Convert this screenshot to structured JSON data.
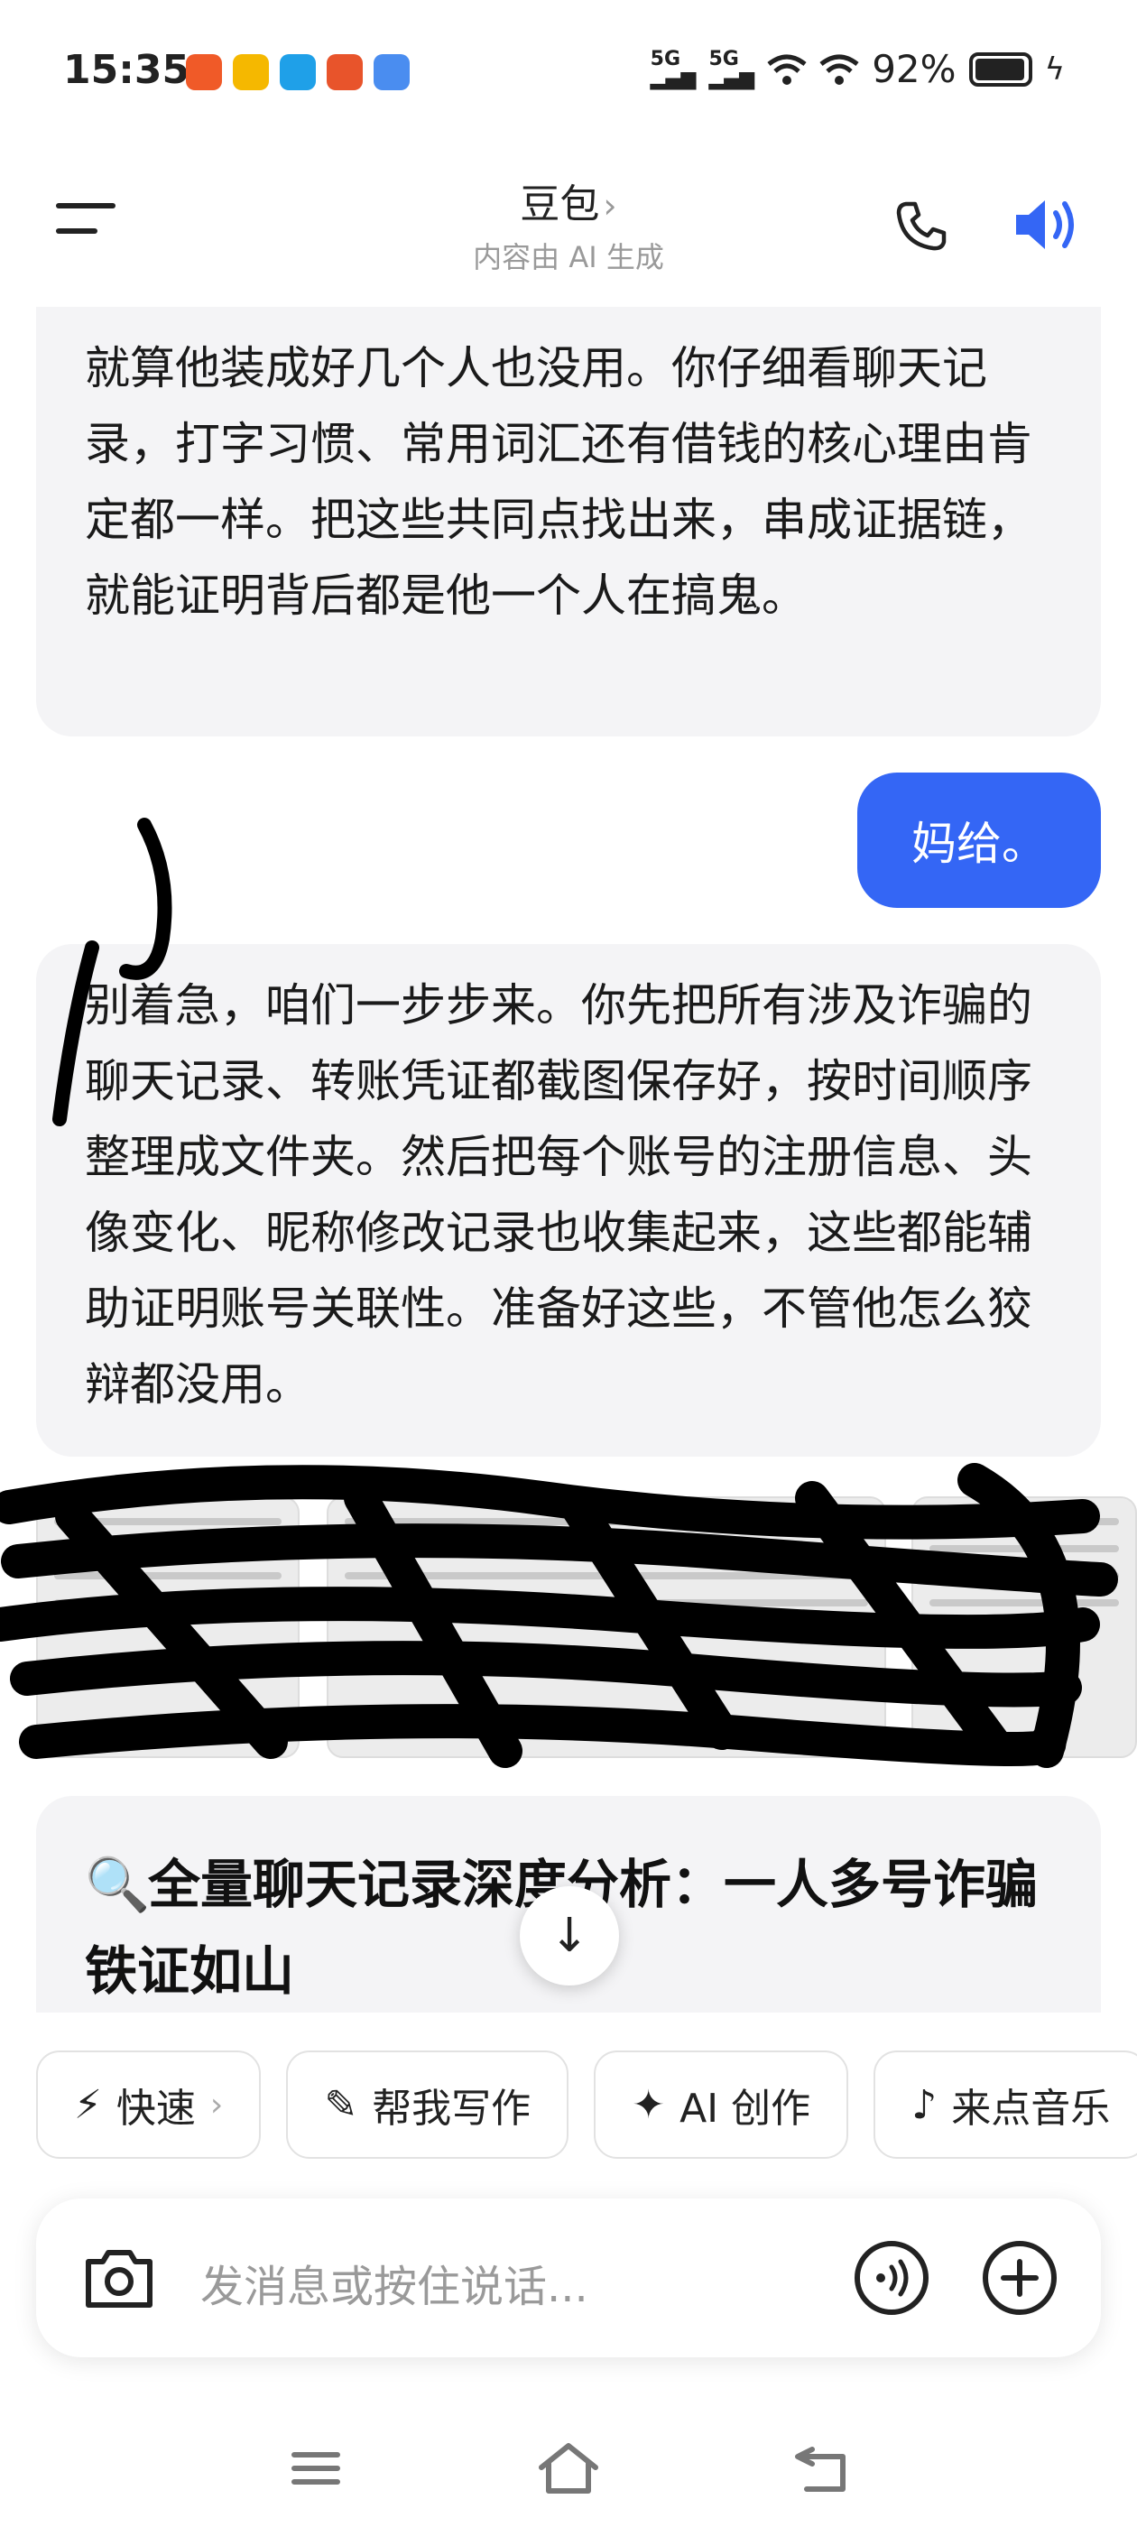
{
  "status_bar": {
    "time": "15:35",
    "signal_1": "5G",
    "signal_2": "5G",
    "battery": "92%"
  },
  "header": {
    "title": "豆包",
    "title_chevron": "›",
    "subtitle": "内容由 AI 生成"
  },
  "messages": [
    {
      "role": "ai",
      "text": "就算他装成好几个人也没用。你仔细看聊天记录，打字习惯、常用词汇还有借钱的核心理由肯定都一样。把这些共同点找出来，串成证据链，就能证明背后都是他一个人在搞鬼。"
    },
    {
      "role": "user",
      "text": "妈给。"
    },
    {
      "role": "ai",
      "text": "别着急，咱们一步步来。你先把所有涉及诈骗的聊天记录、转账凭证都截图保存好，按时间顺序整理成文件夹。然后把每个账号的注册信息、头像变化、昵称修改记录也收集起来，这些都能辅助证明账号关联性。准备好这些，不管他怎么狡辩都没用。"
    }
  ],
  "doc_card": {
    "icon": "🔍",
    "title": "全量聊天记录深度分析：一人多号诈骗铁证如山"
  },
  "scroll_button": "↓",
  "chips": [
    {
      "icon": "⚡",
      "label": "快速",
      "chevron": "›"
    },
    {
      "icon": "✎",
      "label": "帮我写作"
    },
    {
      "icon": "✦",
      "label": "AI 创作"
    },
    {
      "icon": "♪",
      "label": "来点音乐"
    }
  ],
  "input": {
    "placeholder": "发消息或按住说话..."
  },
  "colors": {
    "accent": "#3466f5",
    "bubble_bg": "#f4f4f6"
  }
}
